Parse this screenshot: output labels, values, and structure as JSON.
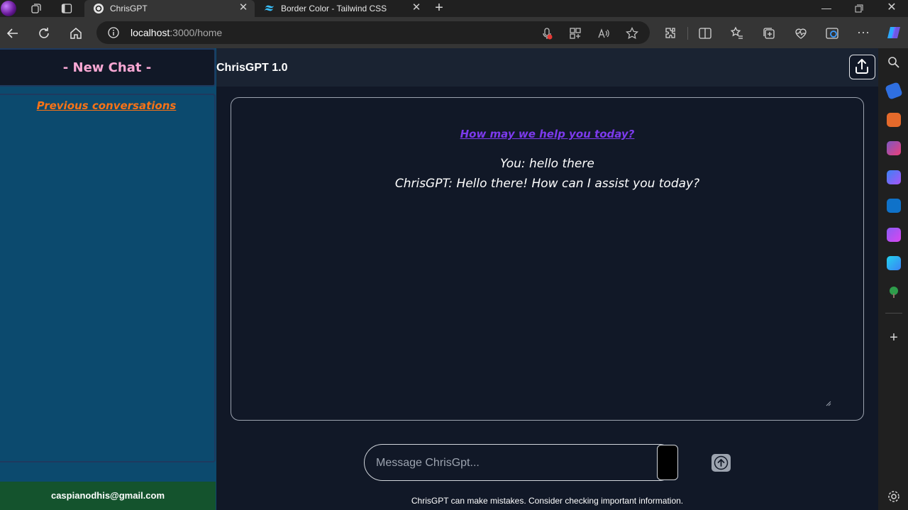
{
  "browser": {
    "tabs": [
      {
        "title": "ChrisGPT",
        "active": true
      },
      {
        "title": "Border Color - Tailwind CSS",
        "active": false
      }
    ],
    "url_host": "localhost",
    "url_rest": ":3000/home"
  },
  "app": {
    "new_chat_label": "- New Chat -",
    "history_title": "Previous conversations",
    "user_email": "caspianodhis@gmail.com",
    "title": "ChrisGPT 1.0",
    "chat_heading": "How may we help you today?",
    "messages": [
      {
        "text": "You: hello there"
      },
      {
        "text": "ChrisGPT: Hello there! How can I assist you today?"
      }
    ],
    "input_placeholder": "Message ChrisGpt...",
    "disclaimer": "ChrisGPT can make mistakes. Consider checking important information."
  },
  "colors": {
    "app_bg": "#111827",
    "sidebar_bg": "#0c4a6e",
    "new_chat_text": "#f9a8d4",
    "history_title": "#f97316",
    "chat_heading": "#7c3aed",
    "email_bg": "#14532d"
  }
}
